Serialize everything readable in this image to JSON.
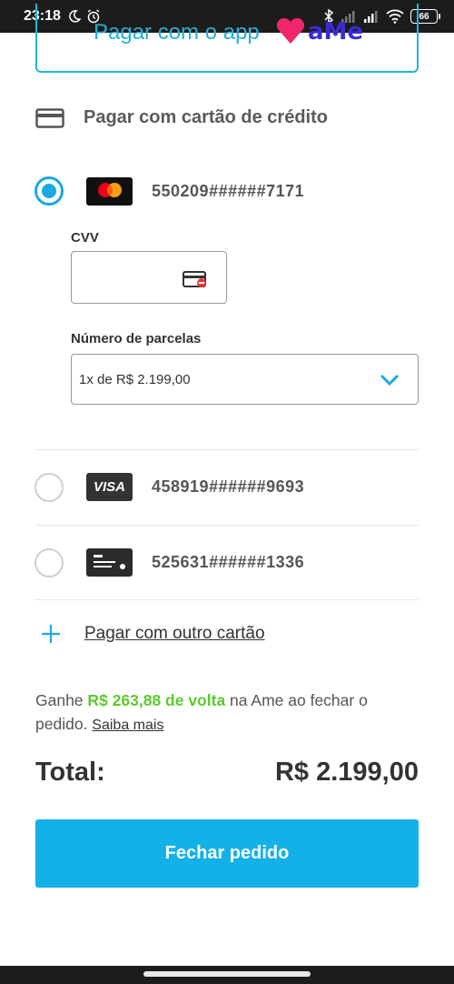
{
  "status_bar": {
    "time": "23:18",
    "battery": "66",
    "icons": [
      "moon-icon",
      "alarm-icon",
      "bluetooth-icon",
      "signal-icon",
      "signal-icon",
      "wifi-icon",
      "battery-icon"
    ]
  },
  "ame_option": {
    "text": "Pagar com o app",
    "logo": "aMe"
  },
  "credit_section": {
    "title": "Pagar com cartão de crédito",
    "icon": "credit-card-icon"
  },
  "cards": [
    {
      "brand": "mastercard",
      "brand_text": "mastercard",
      "number": "550209######7171",
      "selected": true
    },
    {
      "brand": "visa",
      "brand_text": "VISA",
      "number": "458919######9693",
      "selected": false
    },
    {
      "brand": "generic",
      "brand_text": "",
      "number": "525631######1336",
      "selected": false
    }
  ],
  "cvv": {
    "label": "CVV",
    "value": "",
    "icon": "card-cvv-icon"
  },
  "installments": {
    "label": "Número de parcelas",
    "selected": "1x de R$ 2.199,00",
    "icon": "chevron-down-icon"
  },
  "add_card": {
    "label": "Pagar com outro cartão",
    "icon": "plus-icon"
  },
  "cashback": {
    "prefix": "Ganhe",
    "amount": "R$ 263,88 de volta",
    "suffix": "na Ame ao fechar o pedido.",
    "link": "Saiba mais"
  },
  "total": {
    "label": "Total:",
    "value": "R$ 2.199,00"
  },
  "checkout_button": "Fechar pedido",
  "colors": {
    "accent": "#14b1e8",
    "cashback": "#5ccb2f",
    "ame_brand": "#3a2bd6"
  }
}
